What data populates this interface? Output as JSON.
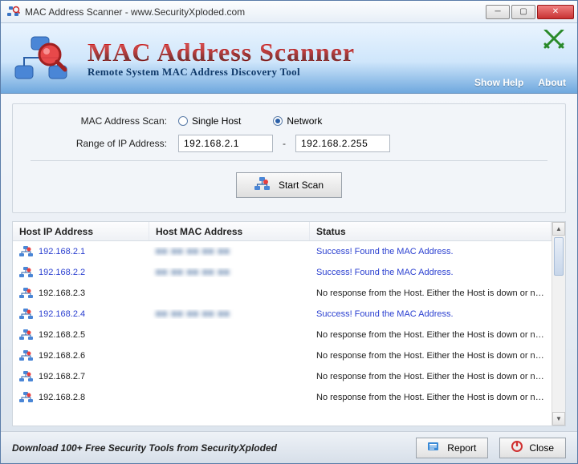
{
  "window": {
    "title": "MAC Address Scanner - www.SecurityXploded.com"
  },
  "banner": {
    "title": "MAC Address Scanner",
    "subtitle": "Remote System MAC Address Discovery Tool",
    "menu": {
      "help": "Show Help",
      "about": "About"
    }
  },
  "form": {
    "scan_label": "MAC Address Scan:",
    "opt_single": "Single Host",
    "opt_network": "Network",
    "selected": "network",
    "range_label": "Range of IP Address:",
    "ip_from": "192.168.2.1",
    "ip_to": "192.168.2.255",
    "dash": "-",
    "scan_btn": "Start Scan"
  },
  "table": {
    "headers": {
      "ip": "Host IP Address",
      "mac": "Host MAC Address",
      "status": "Status"
    },
    "status_success": "Success! Found the MAC Address.",
    "status_fail": "No response from the Host. Either the Host is down or not rea...",
    "rows": [
      {
        "ip": "192.168.2.1",
        "mac": "■■ ■■ ■■ ■■ ■■",
        "success": true
      },
      {
        "ip": "192.168.2.2",
        "mac": "■■ ■■ ■■ ■■ ■■",
        "success": true
      },
      {
        "ip": "192.168.2.3",
        "mac": "",
        "success": false
      },
      {
        "ip": "192.168.2.4",
        "mac": "■■ ■■ ■■ ■■ ■■",
        "success": true
      },
      {
        "ip": "192.168.2.5",
        "mac": "",
        "success": false
      },
      {
        "ip": "192.168.2.6",
        "mac": "",
        "success": false
      },
      {
        "ip": "192.168.2.7",
        "mac": "",
        "success": false
      },
      {
        "ip": "192.168.2.8",
        "mac": "",
        "success": false
      }
    ]
  },
  "footer": {
    "download_text": "Download 100+ Free Security Tools from SecurityXploded",
    "report_btn": "Report",
    "close_btn": "Close"
  }
}
